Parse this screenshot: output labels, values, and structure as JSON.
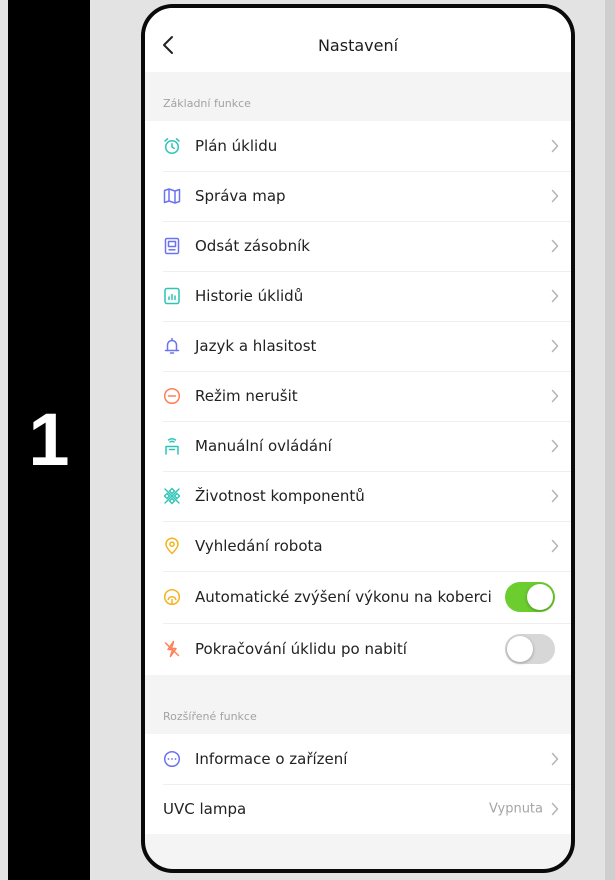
{
  "step": "1",
  "header": {
    "title": "Nastavení"
  },
  "sections": {
    "basic": "Základní funkce",
    "extended": "Rozšířené funkce"
  },
  "items": [
    {
      "label": "Plán úklidu",
      "icon": "alarm-clock-icon",
      "color": "#2ec4b6"
    },
    {
      "label": "Správa map",
      "icon": "map-icon",
      "color": "#6b73f2"
    },
    {
      "label": "Odsát zásobník",
      "icon": "dustbin-icon",
      "color": "#6b73f2"
    },
    {
      "label": "Historie úklidů",
      "icon": "history-chart-icon",
      "color": "#2ec4b6"
    },
    {
      "label": "Jazyk a hlasitost",
      "icon": "bell-icon",
      "color": "#6b73f2"
    },
    {
      "label": "Režim nerušit",
      "icon": "do-not-disturb-icon",
      "color": "#ff7f57"
    },
    {
      "label": "Manuální ovládání",
      "icon": "remote-control-icon",
      "color": "#2ec4b6"
    },
    {
      "label": "Životnost komponentů",
      "icon": "components-icon",
      "color": "#2ec4b6"
    },
    {
      "label": "Vyhledání robota",
      "icon": "location-pin-icon",
      "color": "#f5b322"
    }
  ],
  "toggles": [
    {
      "label": "Automatické zvýšení výkonu na koberci",
      "icon": "carpet-boost-icon",
      "color": "#f5b322",
      "state": "on"
    },
    {
      "label": "Pokračování úklidu po nabití",
      "icon": "charge-bolt-icon",
      "color": "#ff7f57",
      "state": "off"
    }
  ],
  "extended_items": [
    {
      "label": "Informace o  zařízení",
      "icon": "info-dots-icon",
      "color": "#6b73f2"
    },
    {
      "label": "UVC lampa",
      "value": "Vypnuta"
    }
  ],
  "colors": {
    "toggle_on": "#6ccd2e",
    "toggle_off": "#d7d7d7",
    "background": "#f4f4f4"
  }
}
